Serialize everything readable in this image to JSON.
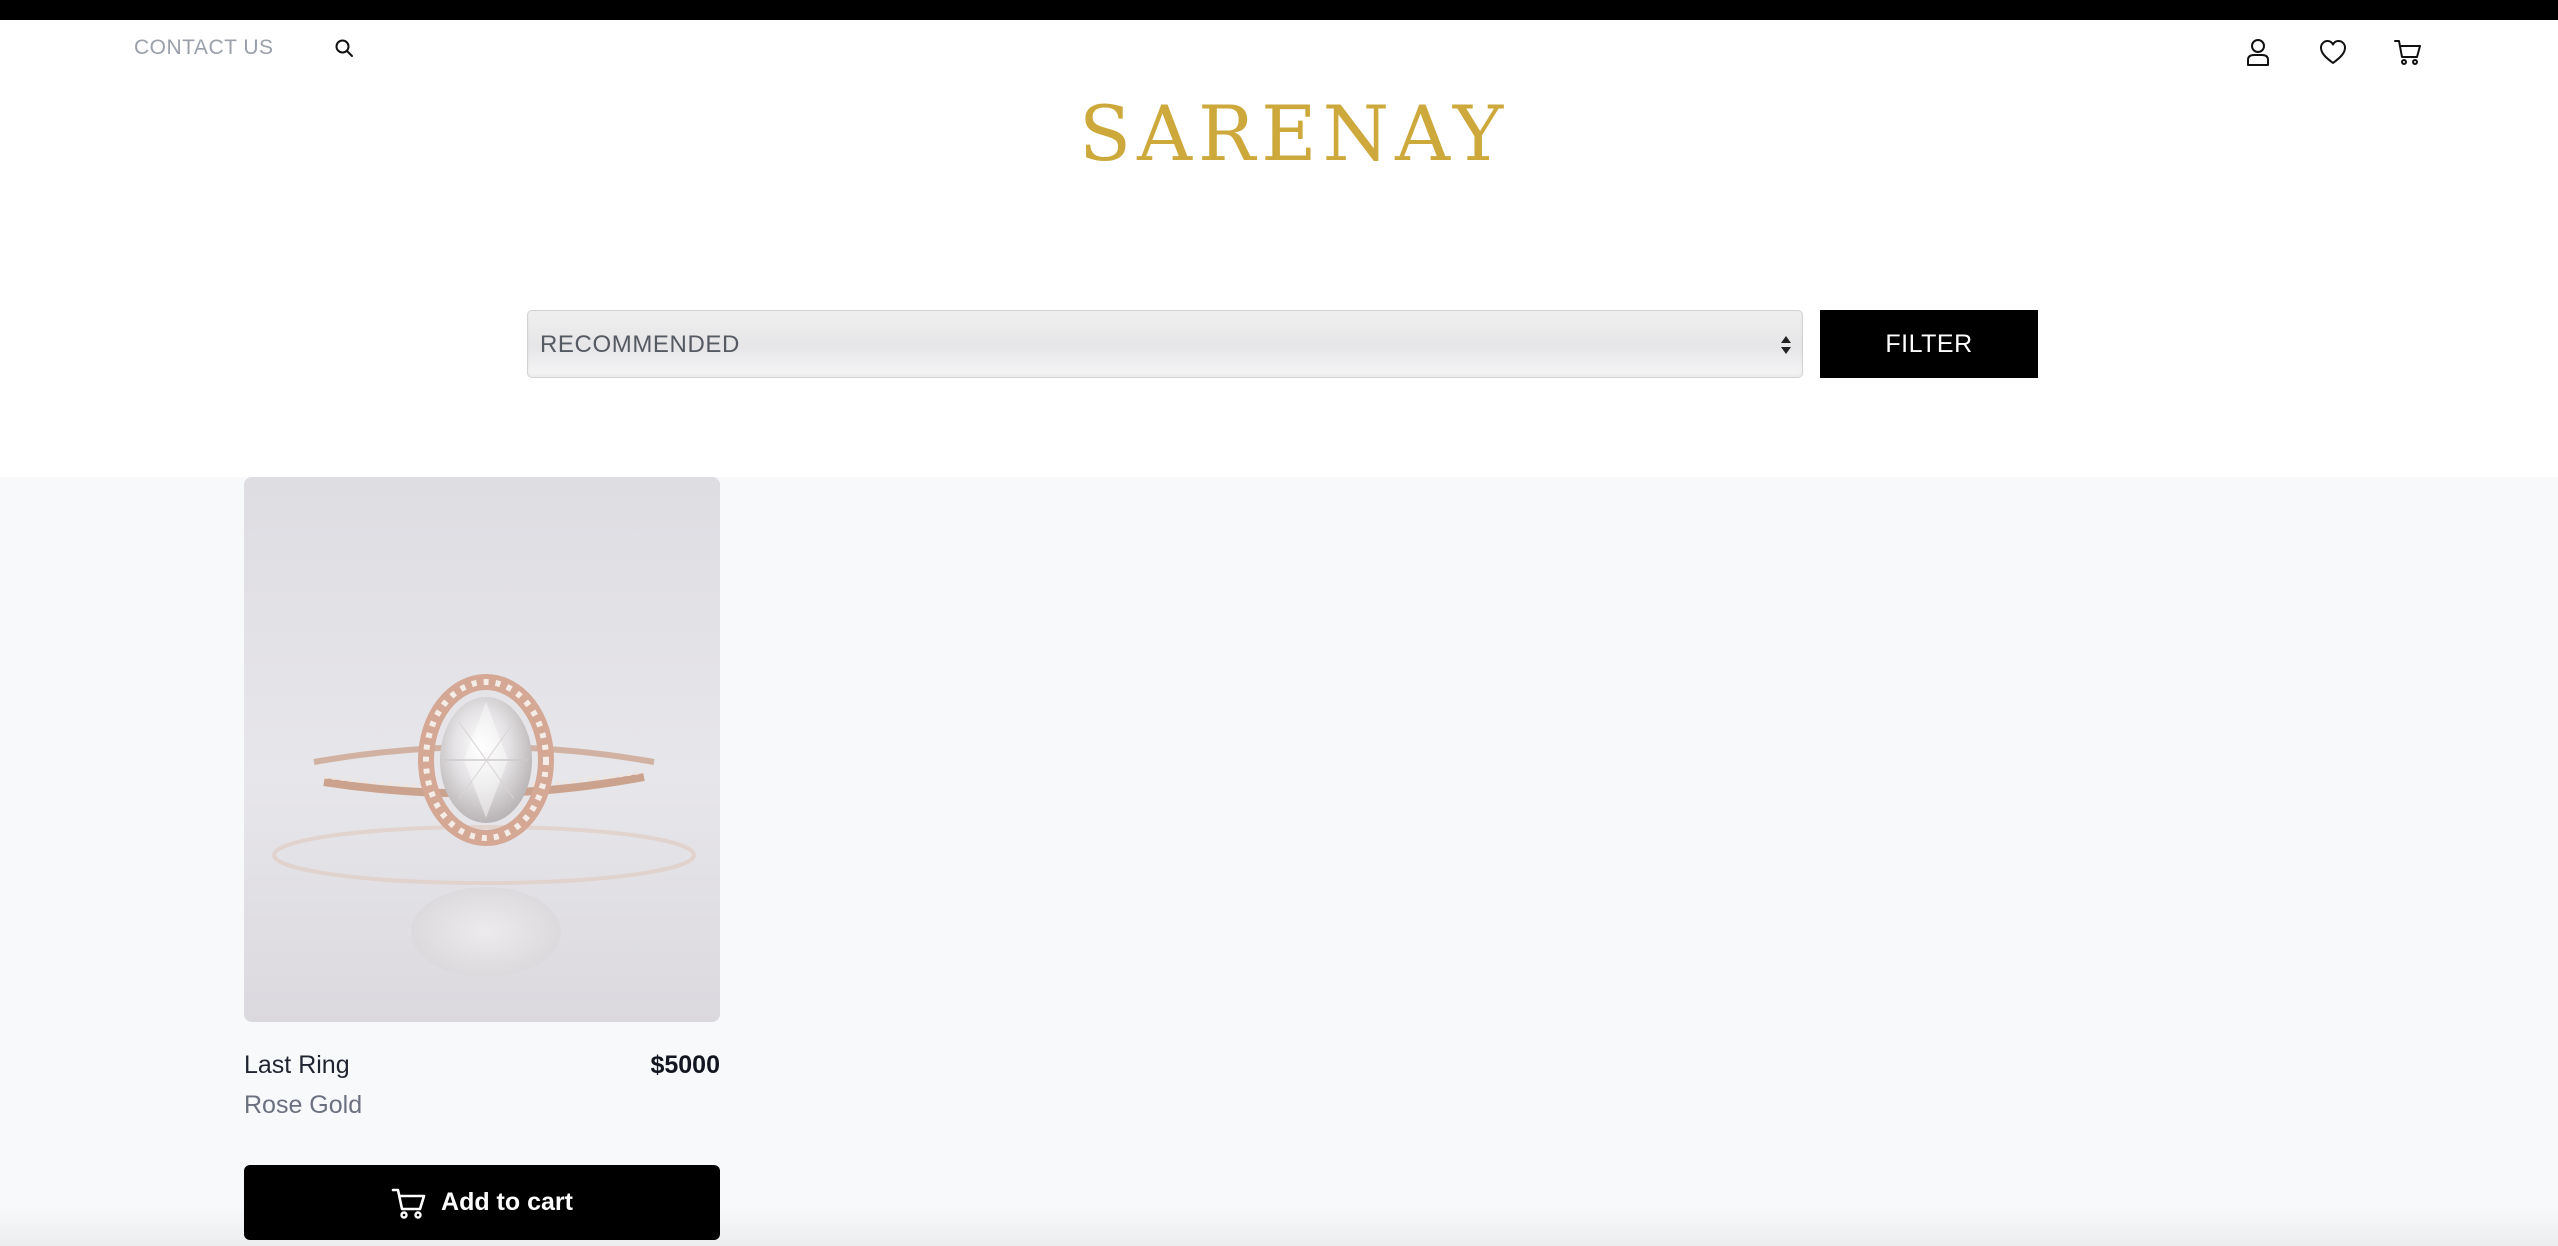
{
  "header": {
    "contact_label": "CONTACT US",
    "logo_text": "SARENAY",
    "icons": {
      "search": "search-icon",
      "account": "user-icon",
      "wishlist": "heart-icon",
      "cart": "cart-icon"
    }
  },
  "toolbar": {
    "sort_selected": "RECOMMENDED",
    "filter_label": "FILTER"
  },
  "products": [
    {
      "name": "Last Ring",
      "price": "$5000",
      "variant": "Rose Gold",
      "add_to_cart_label": "Add to cart"
    }
  ],
  "colors": {
    "brand_gold": "#cda93c",
    "primary_black": "#000000",
    "product_background": "#f8f9fb"
  }
}
